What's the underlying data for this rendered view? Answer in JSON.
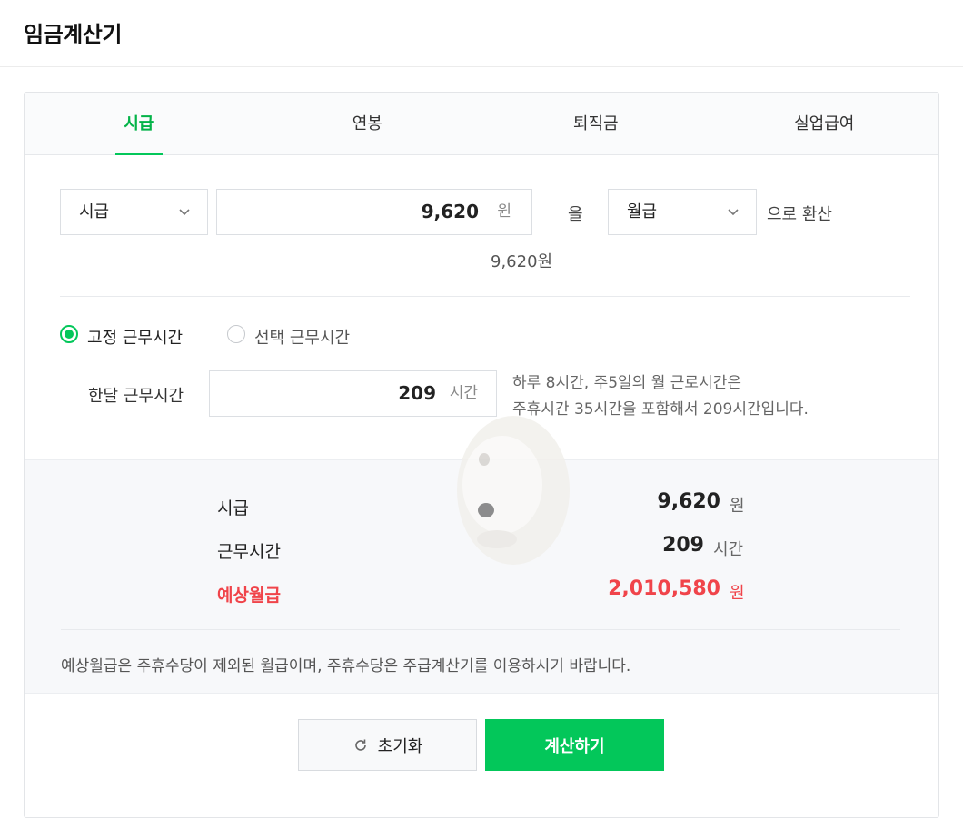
{
  "header": {
    "title": "임금계산기"
  },
  "tabs": [
    {
      "label": "시급",
      "active": true
    },
    {
      "label": "연봉",
      "active": false
    },
    {
      "label": "퇴직금",
      "active": false
    },
    {
      "label": "실업급여",
      "active": false
    }
  ],
  "converter": {
    "from_select": "시급",
    "amount": "9,620",
    "amount_unit": "원",
    "particle": "을",
    "to_select": "월급",
    "suffix": "으로 환산",
    "amount_readout": "9,620원"
  },
  "work_hours": {
    "radio_fixed": "고정 근무시간",
    "radio_fixed_checked": true,
    "radio_select": "선택 근무시간",
    "radio_select_checked": false,
    "label": "한달 근무시간",
    "value": "209",
    "unit": "시간",
    "hint_line1": "하루 8시간, 주5일의 월 근로시간은",
    "hint_line2": "주휴시간 35시간을 포함해서 209시간입니다."
  },
  "results": {
    "rows": [
      {
        "label": "시급",
        "value": "9,620",
        "unit": "원"
      },
      {
        "label": "근무시간",
        "value": "209",
        "unit": "시간"
      },
      {
        "label": "예상월급",
        "value": "2,010,580",
        "unit": "원"
      }
    ],
    "notice": "예상월급은 주휴수당이 제외된 월급이며, 주휴수당은 주급계산기를 이용하시기 바랍니다."
  },
  "buttons": {
    "reset": "초기화",
    "calculate": "계산하기"
  },
  "icons": {
    "select_arrow": "chevron-down-icon",
    "reset": "refresh-icon",
    "watermark": "dog-mascot-icon"
  },
  "colors": {
    "accent": "#03c75a",
    "highlight": "#f0444a"
  }
}
